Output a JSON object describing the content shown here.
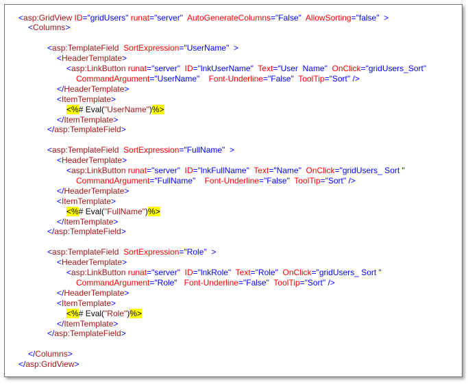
{
  "colors": {
    "tag": "#a31515",
    "bracket": "#0000ff",
    "attribute": "#ff0000",
    "text": "#000000",
    "highlight": "#ffff00"
  },
  "lines": [
    {
      "indent": 0,
      "tokens": [
        {
          "k": "b",
          "t": "<"
        },
        {
          "k": "t",
          "t": "asp:GridView"
        },
        {
          "k": "r",
          "t": " ID"
        },
        {
          "k": "b",
          "t": "=\"gridUsers\""
        },
        {
          "k": "r",
          "t": " runat"
        },
        {
          "k": "b",
          "t": "=\"server\""
        },
        {
          "k": "r",
          "t": "  AutoGenerateColumns"
        },
        {
          "k": "b",
          "t": "=\"False\""
        },
        {
          "k": "r",
          "t": "  AllowSorting"
        },
        {
          "k": "b",
          "t": "=\"false\""
        },
        {
          "k": "b",
          "t": "  >"
        }
      ]
    },
    {
      "indent": 1,
      "tokens": [
        {
          "k": "b",
          "t": "<"
        },
        {
          "k": "t",
          "t": "Columns"
        },
        {
          "k": "b",
          "t": ">"
        }
      ]
    },
    {
      "blank": true
    },
    {
      "indent": 2,
      "tokens": [
        {
          "k": "b",
          "t": "<"
        },
        {
          "k": "t",
          "t": "asp:TemplateField"
        },
        {
          "k": "r",
          "t": "  SortExpression"
        },
        {
          "k": "b",
          "t": "=\"UserName\""
        },
        {
          "k": "b",
          "t": "  >"
        }
      ]
    },
    {
      "indent": 3,
      "tokens": [
        {
          "k": "b",
          "t": "<"
        },
        {
          "k": "t",
          "t": "HeaderTemplate"
        },
        {
          "k": "b",
          "t": ">"
        }
      ]
    },
    {
      "indent": 4,
      "tokens": [
        {
          "k": "b",
          "t": "<"
        },
        {
          "k": "t",
          "t": "asp:LinkButton"
        },
        {
          "k": "r",
          "t": " runat"
        },
        {
          "k": "b",
          "t": "=\"server\""
        },
        {
          "k": "r",
          "t": "  ID"
        },
        {
          "k": "b",
          "t": "=\"lnkUserName\""
        },
        {
          "k": "r",
          "t": "  Text"
        },
        {
          "k": "b",
          "t": "=\"User  Name\""
        },
        {
          "k": "r",
          "t": "  OnClick"
        },
        {
          "k": "b",
          "t": "=\"gridUsers_Sort\""
        }
      ]
    },
    {
      "indent": 5,
      "tokens": [
        {
          "k": "r",
          "t": "CommandArgument"
        },
        {
          "k": "b",
          "t": "=\"UserName\""
        },
        {
          "k": "r",
          "t": "    Font-Underline"
        },
        {
          "k": "b",
          "t": "=\"False\""
        },
        {
          "k": "r",
          "t": "  ToolTip"
        },
        {
          "k": "b",
          "t": "=\"Sort\""
        },
        {
          "k": "b",
          "t": " />"
        }
      ]
    },
    {
      "indent": 3,
      "tokens": [
        {
          "k": "b",
          "t": "</"
        },
        {
          "k": "t",
          "t": "HeaderTemplate"
        },
        {
          "k": "b",
          "t": ">"
        }
      ]
    },
    {
      "indent": 3,
      "tokens": [
        {
          "k": "b",
          "t": "<"
        },
        {
          "k": "t",
          "t": "ItemTemplate"
        },
        {
          "k": "b",
          "t": ">"
        }
      ]
    },
    {
      "indent": 4,
      "tokens": [
        {
          "k": "hl",
          "t": "<%"
        },
        {
          "k": "k",
          "t": "# Eval("
        },
        {
          "k": "t",
          "t": "\"UserName\""
        },
        {
          "k": "k",
          "t": ")"
        },
        {
          "k": "hl",
          "t": "%>"
        }
      ]
    },
    {
      "indent": 3,
      "tokens": [
        {
          "k": "b",
          "t": "</"
        },
        {
          "k": "t",
          "t": "ItemTemplate"
        },
        {
          "k": "b",
          "t": ">"
        }
      ]
    },
    {
      "indent": 2,
      "tokens": [
        {
          "k": "b",
          "t": "</"
        },
        {
          "k": "t",
          "t": "asp:TemplateField"
        },
        {
          "k": "b",
          "t": ">"
        }
      ]
    },
    {
      "blank": true
    },
    {
      "indent": 2,
      "tokens": [
        {
          "k": "b",
          "t": "<"
        },
        {
          "k": "t",
          "t": "asp:TemplateField"
        },
        {
          "k": "r",
          "t": "  SortExpression"
        },
        {
          "k": "b",
          "t": "=\"FullName\""
        },
        {
          "k": "b",
          "t": "  >"
        }
      ]
    },
    {
      "indent": 3,
      "tokens": [
        {
          "k": "b",
          "t": "<"
        },
        {
          "k": "t",
          "t": "HeaderTemplate"
        },
        {
          "k": "b",
          "t": ">"
        }
      ]
    },
    {
      "indent": 4,
      "tokens": [
        {
          "k": "b",
          "t": "<"
        },
        {
          "k": "t",
          "t": "asp:LinkButton"
        },
        {
          "k": "r",
          "t": " runat"
        },
        {
          "k": "b",
          "t": "=\"server\""
        },
        {
          "k": "r",
          "t": "  ID"
        },
        {
          "k": "b",
          "t": "=\"lnkFullName\""
        },
        {
          "k": "r",
          "t": "  Text"
        },
        {
          "k": "b",
          "t": "=\"Name\""
        },
        {
          "k": "r",
          "t": "  OnClick"
        },
        {
          "k": "b",
          "t": "=\"gridUsers_ Sort \""
        }
      ]
    },
    {
      "indent": 5,
      "tokens": [
        {
          "k": "r",
          "t": "CommandArgument"
        },
        {
          "k": "b",
          "t": "=\"FullName\""
        },
        {
          "k": "r",
          "t": "    Font-Underline"
        },
        {
          "k": "b",
          "t": "=\"False\""
        },
        {
          "k": "r",
          "t": "  ToolTip"
        },
        {
          "k": "b",
          "t": "=\"Sort\""
        },
        {
          "k": "b",
          "t": " />"
        }
      ]
    },
    {
      "indent": 3,
      "tokens": [
        {
          "k": "b",
          "t": "</"
        },
        {
          "k": "t",
          "t": "HeaderTemplate"
        },
        {
          "k": "b",
          "t": ">"
        }
      ]
    },
    {
      "indent": 3,
      "tokens": [
        {
          "k": "b",
          "t": "<"
        },
        {
          "k": "t",
          "t": "ItemTemplate"
        },
        {
          "k": "b",
          "t": ">"
        }
      ]
    },
    {
      "indent": 4,
      "tokens": [
        {
          "k": "hl",
          "t": "<%"
        },
        {
          "k": "k",
          "t": "# Eval("
        },
        {
          "k": "t",
          "t": "\"FullName\""
        },
        {
          "k": "k",
          "t": ")"
        },
        {
          "k": "hl",
          "t": "%>"
        }
      ]
    },
    {
      "indent": 3,
      "tokens": [
        {
          "k": "b",
          "t": "</"
        },
        {
          "k": "t",
          "t": "ItemTemplate"
        },
        {
          "k": "b",
          "t": ">"
        }
      ]
    },
    {
      "indent": 2,
      "tokens": [
        {
          "k": "b",
          "t": "</"
        },
        {
          "k": "t",
          "t": "asp:TemplateField"
        },
        {
          "k": "b",
          "t": ">"
        }
      ]
    },
    {
      "blank": true
    },
    {
      "indent": 2,
      "tokens": [
        {
          "k": "b",
          "t": "<"
        },
        {
          "k": "t",
          "t": "asp:TemplateField"
        },
        {
          "k": "r",
          "t": "  SortExpression"
        },
        {
          "k": "b",
          "t": "=\"Role\""
        },
        {
          "k": "b",
          "t": "  >"
        }
      ]
    },
    {
      "indent": 3,
      "tokens": [
        {
          "k": "b",
          "t": "<"
        },
        {
          "k": "t",
          "t": "HeaderTemplate"
        },
        {
          "k": "b",
          "t": ">"
        }
      ]
    },
    {
      "indent": 4,
      "tokens": [
        {
          "k": "b",
          "t": "<"
        },
        {
          "k": "t",
          "t": "asp:LinkButton"
        },
        {
          "k": "r",
          "t": " runat"
        },
        {
          "k": "b",
          "t": "=\"server\""
        },
        {
          "k": "r",
          "t": "  ID"
        },
        {
          "k": "b",
          "t": "=\"lnkRole\""
        },
        {
          "k": "r",
          "t": "  Text"
        },
        {
          "k": "b",
          "t": "=\"Role\""
        },
        {
          "k": "r",
          "t": "  OnClick"
        },
        {
          "k": "b",
          "t": "=\"gridUsers_ Sort \""
        }
      ]
    },
    {
      "indent": 5,
      "tokens": [
        {
          "k": "r",
          "t": "CommandArgument"
        },
        {
          "k": "b",
          "t": "=\"Role\""
        },
        {
          "k": "r",
          "t": "   Font-Underline"
        },
        {
          "k": "b",
          "t": "=\"False\""
        },
        {
          "k": "r",
          "t": "  ToolTip"
        },
        {
          "k": "b",
          "t": "=\"Sort\""
        },
        {
          "k": "b",
          "t": " />"
        }
      ]
    },
    {
      "indent": 3,
      "tokens": [
        {
          "k": "b",
          "t": "</"
        },
        {
          "k": "t",
          "t": "HeaderTemplate"
        },
        {
          "k": "b",
          "t": ">"
        }
      ]
    },
    {
      "indent": 3,
      "tokens": [
        {
          "k": "b",
          "t": "<"
        },
        {
          "k": "t",
          "t": "ItemTemplate"
        },
        {
          "k": "b",
          "t": ">"
        }
      ]
    },
    {
      "indent": 4,
      "tokens": [
        {
          "k": "hl",
          "t": "<%"
        },
        {
          "k": "k",
          "t": "# Eval("
        },
        {
          "k": "t",
          "t": "\"Role\""
        },
        {
          "k": "k",
          "t": ")"
        },
        {
          "k": "hl",
          "t": "%>"
        }
      ]
    },
    {
      "indent": 3,
      "tokens": [
        {
          "k": "b",
          "t": "</"
        },
        {
          "k": "t",
          "t": "ItemTemplate"
        },
        {
          "k": "b",
          "t": ">"
        }
      ]
    },
    {
      "indent": 2,
      "tokens": [
        {
          "k": "b",
          "t": "</"
        },
        {
          "k": "t",
          "t": "asp:TemplateField"
        },
        {
          "k": "b",
          "t": ">"
        }
      ]
    },
    {
      "blank": true
    },
    {
      "indent": 1,
      "tokens": [
        {
          "k": "b",
          "t": "</"
        },
        {
          "k": "t",
          "t": "Columns"
        },
        {
          "k": "b",
          "t": ">"
        }
      ]
    },
    {
      "indent": 0,
      "tokens": [
        {
          "k": "b",
          "t": "</"
        },
        {
          "k": "t",
          "t": "asp:GridView"
        },
        {
          "k": "b",
          "t": ">"
        }
      ]
    }
  ]
}
